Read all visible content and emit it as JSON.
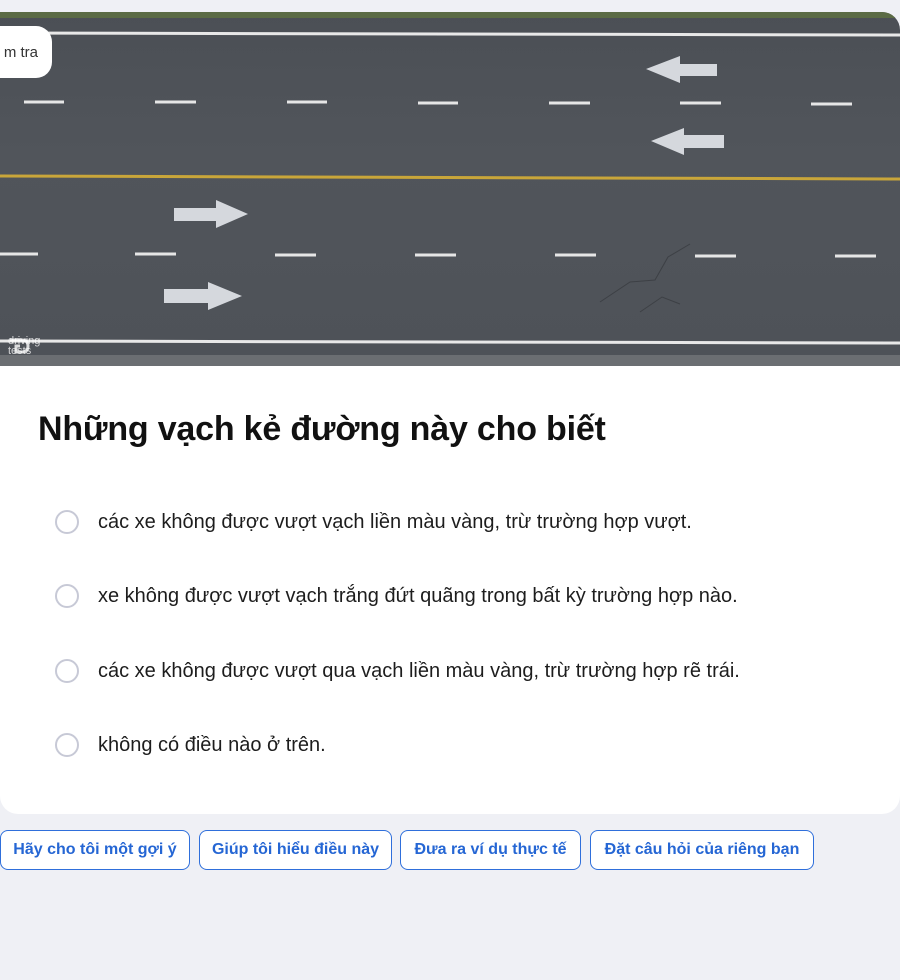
{
  "header": {
    "tab_label": "m tra"
  },
  "image": {
    "watermark": "driving tests"
  },
  "question": {
    "text": "Những vạch kẻ đường này cho biết"
  },
  "options": [
    {
      "text": "các xe không được vượt vạch liền màu vàng, trừ trường hợp vượt."
    },
    {
      "text": "xe không được vượt vạch trắng đứt quãng trong bất kỳ trường hợp nào."
    },
    {
      "text": "các xe không được vượt qua vạch liền màu vàng, trừ trường hợp rẽ trái."
    },
    {
      "text": "không có điều nào ở trên."
    }
  ],
  "actions": [
    {
      "label": "Hãy cho tôi một gợi ý"
    },
    {
      "label": "Giúp tôi hiểu điều này"
    },
    {
      "label": "Đưa ra ví dụ thực tế"
    },
    {
      "label": "Đặt câu hỏi của riêng bạn"
    }
  ],
  "colors": {
    "accent": "#2566d4",
    "road_yellow": "#c9a63a",
    "background": "#eff0f5"
  }
}
